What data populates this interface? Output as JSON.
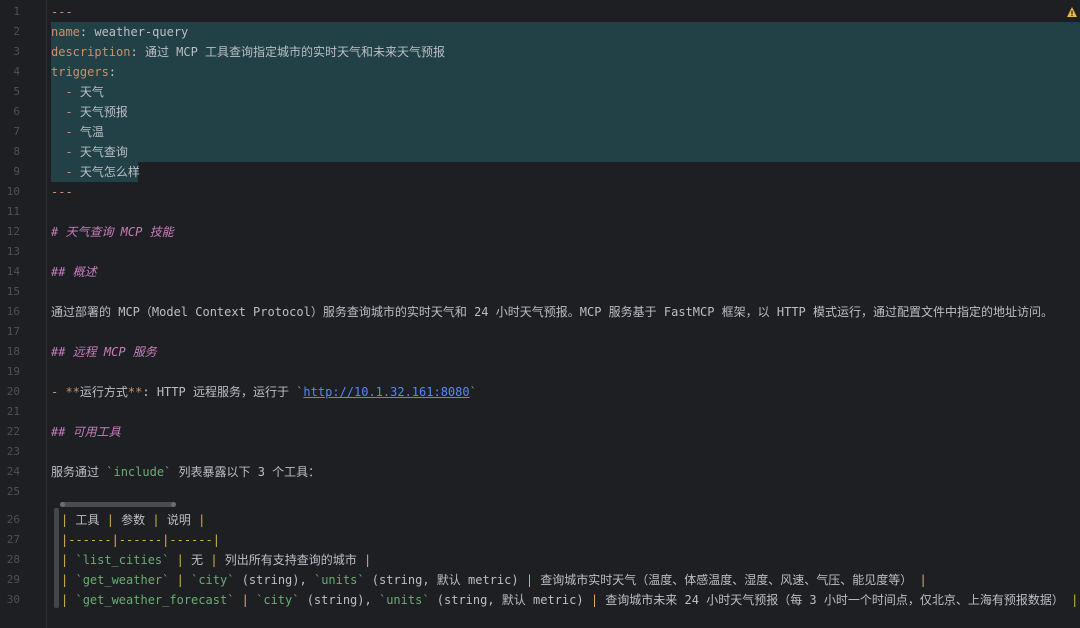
{
  "line_numbers": [
    "1",
    "2",
    "3",
    "4",
    "5",
    "6",
    "7",
    "8",
    "9",
    "10",
    "11",
    "12",
    "13",
    "14",
    "15",
    "16",
    "17",
    "18",
    "19",
    "20",
    "21",
    "22",
    "23",
    "24",
    "25",
    "26",
    "27",
    "28",
    "29",
    "30"
  ],
  "frontmatter": {
    "delim": "---",
    "name_key": "name",
    "name_value": "weather-query",
    "desc_key": "description",
    "desc_value": "通过 MCP 工具查询指定城市的实时天气和未来天气预报",
    "triggers_key": "triggers",
    "triggers": [
      "天气",
      "天气预报",
      "气温",
      "天气查询",
      "天气怎么样"
    ]
  },
  "h1": "# 天气查询 MCP 技能",
  "h2_overview": "## 概述",
  "overview_text": "通过部署的 MCP（Model Context Protocol）服务查询城市的实时天气和 24 小时天气预报。MCP 服务基于 FastMCP 框架，以 HTTP 模式运行，通过配置文件中指定的地址访问。",
  "h2_remote": "## 远程 MCP 服务",
  "remote_item": {
    "bold": "运行方式",
    "text": ": HTTP 远程服务，运行于 ",
    "url": "http://10.1.32.161:8080"
  },
  "h2_tools": "## 可用工具",
  "tools_intro": {
    "before": "服务通过 ",
    "code": "include",
    "after": " 列表暴露以下 3 个工具："
  },
  "table": {
    "header": [
      "工具",
      "参数",
      "说明"
    ],
    "sep": "|------|------|------|",
    "rows": [
      {
        "tool": "list_cities",
        "params": "无",
        "desc": "列出所有支持查询的城市"
      },
      {
        "tool": "get_weather",
        "params_a": "city",
        "params_b": " (string), ",
        "params_c": "units",
        "params_d": " (string, 默认 metric)",
        "desc": "查询城市实时天气（温度、体感温度、湿度、风速、气压、能见度等）"
      },
      {
        "tool": "get_weather_forecast",
        "params_a": "city",
        "params_b": " (string), ",
        "params_c": "units",
        "params_d": " (string, 默认 metric)",
        "desc": "查询城市未来 24 小时天气预报（每 3 小时一个时间点，仅北京、上海有预报数据）"
      }
    ]
  },
  "colors": {
    "background": "#1e1f22",
    "selection": "#214147",
    "keyword": "#cf8e6d",
    "heading": "#c77dbb",
    "code": "#6aab73",
    "link": "#548af7",
    "table_pipe": "#d7b24a"
  },
  "warning_icon": "warning-icon"
}
